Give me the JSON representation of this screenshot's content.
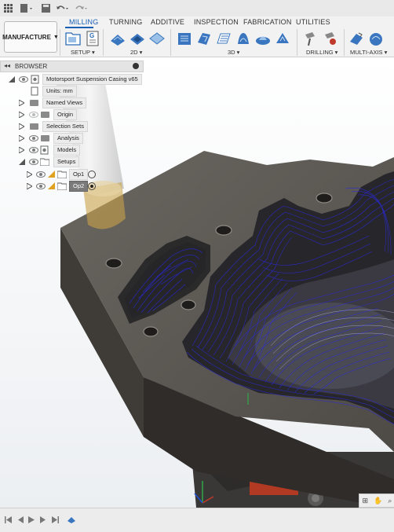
{
  "ribbon": {
    "workspace_label": "MANUFACTURE",
    "tabs": [
      {
        "label": "MILLING",
        "active": true
      },
      {
        "label": "TURNING",
        "active": false
      },
      {
        "label": "ADDITIVE",
        "active": false
      },
      {
        "label": "INSPECTION",
        "active": false
      },
      {
        "label": "FABRICATION",
        "active": false
      },
      {
        "label": "UTILITIES",
        "active": false
      }
    ],
    "groups": {
      "setup": "SETUP",
      "two_d": "2D",
      "three_d": "3D",
      "drilling": "DRILLING",
      "multi_axis": "MULTI-AXIS"
    }
  },
  "browser": {
    "title": "BROWSER",
    "items": [
      {
        "label": "Motorsport Suspension Casing v65"
      },
      {
        "label": "Units: mm"
      },
      {
        "label": "Named Views"
      },
      {
        "label": "Origin"
      },
      {
        "label": "Selection Sets"
      },
      {
        "label": "Analysis"
      },
      {
        "label": "Models"
      },
      {
        "label": "Setups"
      },
      {
        "label": "Op1"
      },
      {
        "label": "Op2",
        "selected": true
      }
    ]
  },
  "icons": [
    "grid-menu-icon",
    "file-icon",
    "save-icon",
    "undo-icon",
    "redo-icon",
    "eye-icon",
    "folder-icon",
    "timeline-play-icon"
  ],
  "colors": {
    "accent": "#1a5fb4",
    "toolpath": "#2a2ad8",
    "part": "#5d5a55",
    "tool": "#c9a24a"
  }
}
